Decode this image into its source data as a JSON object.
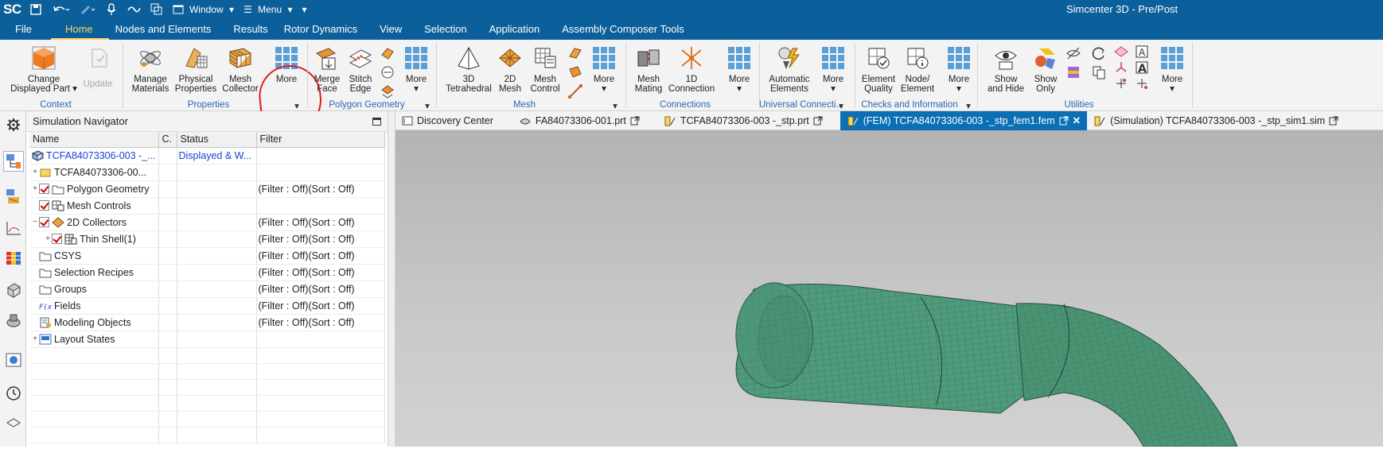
{
  "titlebar": {
    "logo": "SC",
    "window_label": "Window",
    "menu_label": "Menu",
    "app_title": "Simcenter 3D - Pre/Post"
  },
  "menu_tabs": [
    "File",
    "Home",
    "Nodes and Elements",
    "Results",
    "Rotor Dynamics",
    "View",
    "Selection",
    "Application",
    "Assembly Composer Tools"
  ],
  "active_tab": "Home",
  "ribbon": {
    "change_displayed_part": [
      "Change",
      "Displayed Part"
    ],
    "update": "Update",
    "manage_materials": [
      "Manage",
      "Materials"
    ],
    "physical_properties": [
      "Physical",
      "Properties"
    ],
    "mesh_collector": [
      "Mesh",
      "Collector"
    ],
    "more": "More",
    "merge_face": [
      "Merge",
      "Face"
    ],
    "stitch_edge": [
      "Stitch",
      "Edge"
    ],
    "tetrahedral_3d": [
      "3D",
      "Tetrahedral"
    ],
    "mesh_2d": [
      "2D",
      "Mesh"
    ],
    "mesh_control": [
      "Mesh",
      "Control"
    ],
    "mesh_mating": [
      "Mesh",
      "Mating"
    ],
    "connection_1d": [
      "1D",
      "Connection"
    ],
    "automatic_elements": [
      "Automatic",
      "Elements"
    ],
    "element_quality": [
      "Element",
      "Quality"
    ],
    "node_element": [
      "Node/",
      "Element"
    ],
    "show_and_hide": [
      "Show",
      "and Hide"
    ],
    "show_only": [
      "Show",
      "Only"
    ],
    "groups": {
      "context": "Context",
      "properties": "Properties",
      "polygon_geometry": "Polygon Geometry",
      "mesh": "Mesh",
      "connections": "Connections",
      "universal_connections": "Universal Connecti...",
      "checks": "Checks and Information",
      "utilities": "Utilities"
    }
  },
  "navigator": {
    "title": "Simulation Navigator",
    "columns": [
      "Name",
      "C.",
      "Status",
      "Filter"
    ],
    "rows": [
      {
        "name": "TCFA84073306-003 -_...",
        "status": "Displayed & W...",
        "filter": ""
      },
      {
        "name": "TCFA84073306-00...",
        "status": "",
        "filter": ""
      },
      {
        "name": "Polygon Geometry",
        "status": "",
        "filter": "(Filter : Off)(Sort : Off)"
      },
      {
        "name": "Mesh Controls",
        "status": "",
        "filter": ""
      },
      {
        "name": "2D Collectors",
        "status": "",
        "filter": "(Filter : Off)(Sort : Off)"
      },
      {
        "name": "Thin Shell(1)",
        "status": "",
        "filter": "(Filter : Off)(Sort : Off)"
      },
      {
        "name": "CSYS",
        "status": "",
        "filter": "(Filter : Off)(Sort : Off)"
      },
      {
        "name": "Selection Recipes",
        "status": "",
        "filter": "(Filter : Off)(Sort : Off)"
      },
      {
        "name": "Groups",
        "status": "",
        "filter": "(Filter : Off)(Sort : Off)"
      },
      {
        "name": "Fields",
        "status": "",
        "filter": "(Filter : Off)(Sort : Off)"
      },
      {
        "name": "Modeling Objects",
        "status": "",
        "filter": "(Filter : Off)(Sort : Off)"
      },
      {
        "name": "Layout States",
        "status": "",
        "filter": ""
      }
    ]
  },
  "doc_tabs": [
    {
      "label": "Discovery Center",
      "active": false
    },
    {
      "label": "FA84073306-001.prt",
      "active": false
    },
    {
      "label": "TCFA84073306-003 -_stp.prt",
      "active": false
    },
    {
      "label": "(FEM) TCFA84073306-003 -_stp_fem1.fem",
      "active": true
    },
    {
      "label": "(Simulation) TCFA84073306-003 -_stp_sim1.sim",
      "active": false
    }
  ],
  "colors": {
    "brand": "#0b5f9a",
    "accent_tab": "#ffd36a",
    "mesh": "#4f9b7b",
    "annotation": "#e01a1a"
  }
}
